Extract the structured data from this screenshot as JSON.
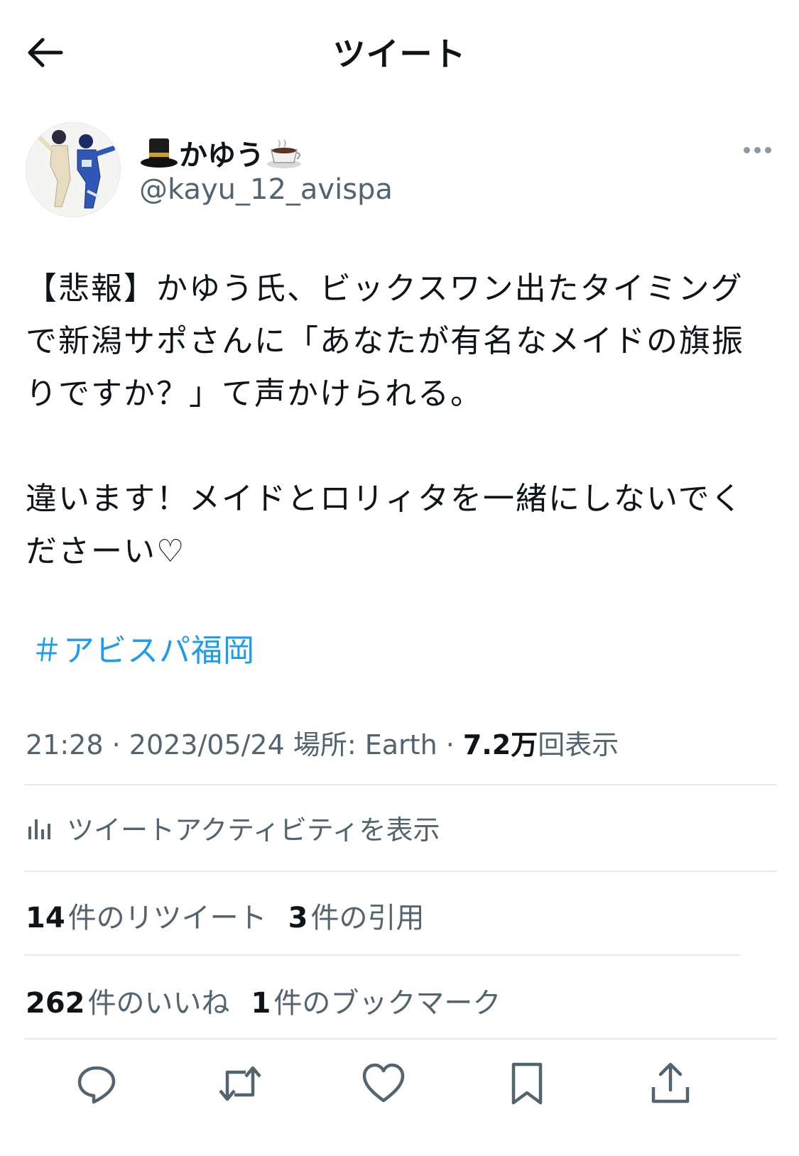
{
  "header": {
    "title": "ツイート",
    "back_icon": "arrow-left-icon"
  },
  "author": {
    "name": "かゆう",
    "name_emoji_left": "top-hat-icon",
    "name_emoji_right": "coffee-cup-icon",
    "handle": "@kayu_12_avispa"
  },
  "tweet": {
    "line1": "【悲報】かゆう氏、ビックスワン出たタイミング",
    "line2": "で新潟サポさんに「あなたが有名なメイドの旗振",
    "line3": "りですか？」て声かけられる。",
    "line4": "違います！メイドとロリィタを一緒にしないでく",
    "line5": "ださーい♡",
    "hashtag": "＃アビスパ福岡"
  },
  "meta": {
    "time": "21:28",
    "sep1": " · ",
    "date": "2023/05/24",
    "place": " 場所: Earth",
    "sep2": " · ",
    "views_count": "7.2万",
    "views_label": "回表示"
  },
  "activity": {
    "label": "ツイートアクティビティを表示",
    "icon": "bar-chart-icon"
  },
  "stats": {
    "retweets_count": "14",
    "retweets_label": "件のリツイート",
    "quotes_count": "3",
    "quotes_label": "件の引用",
    "likes_count": "262",
    "likes_label": "件のいいね",
    "bookmarks_count": "1",
    "bookmarks_label": "件のブックマーク"
  },
  "colors": {
    "text": "#0f1419",
    "secondary": "#536471",
    "link": "#1d9bf0",
    "divider": "#e7e9ea"
  }
}
